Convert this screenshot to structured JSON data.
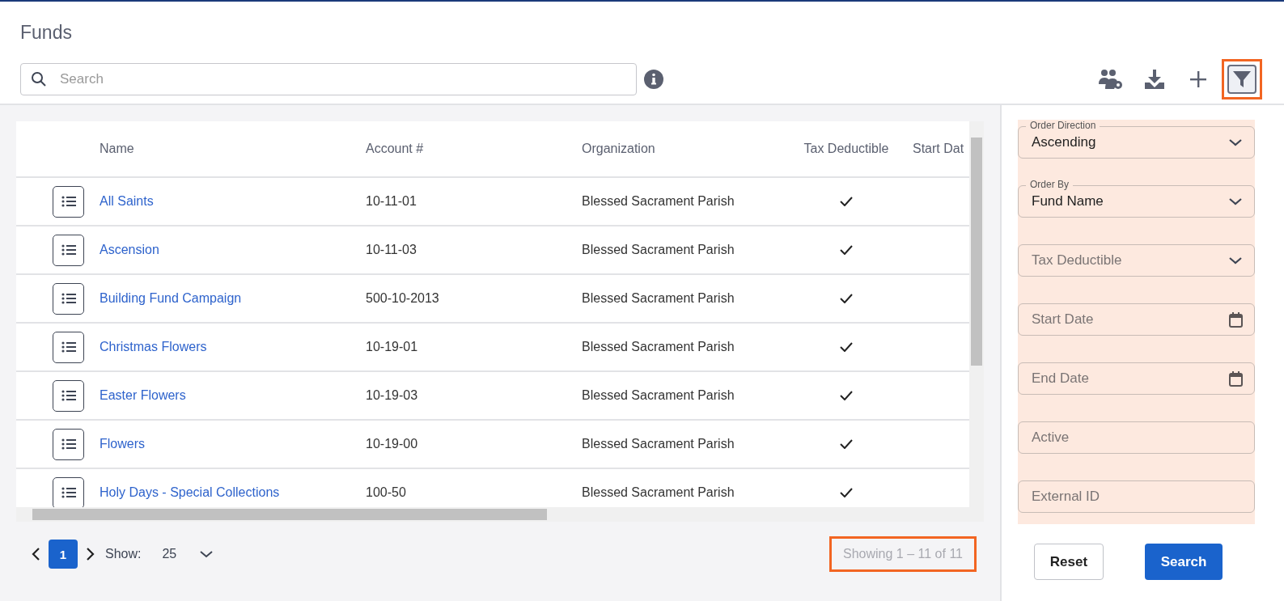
{
  "page": {
    "title": "Funds"
  },
  "search": {
    "placeholder": "Search"
  },
  "toolbar": [
    {
      "kind": "people-settings",
      "highlighted": false,
      "selected": false
    },
    {
      "kind": "download",
      "highlighted": false,
      "selected": false
    },
    {
      "kind": "add",
      "highlighted": false,
      "selected": false
    },
    {
      "kind": "filter",
      "highlighted": true,
      "selected": true
    }
  ],
  "table": {
    "columns": [
      "Name",
      "Account #",
      "Organization",
      "Tax Deductible",
      "Start Dat"
    ],
    "rows": [
      {
        "name": "All Saints",
        "account": "10-11-01",
        "organization": "Blessed Sacrament Parish",
        "tax_deductible": true
      },
      {
        "name": "Ascension",
        "account": "10-11-03",
        "organization": "Blessed Sacrament Parish",
        "tax_deductible": true
      },
      {
        "name": "Building Fund Campaign",
        "account": "500-10-2013",
        "organization": "Blessed Sacrament Parish",
        "tax_deductible": true
      },
      {
        "name": "Christmas Flowers",
        "account": "10-19-01",
        "organization": "Blessed Sacrament Parish",
        "tax_deductible": true
      },
      {
        "name": "Easter Flowers",
        "account": "10-19-03",
        "organization": "Blessed Sacrament Parish",
        "tax_deductible": true
      },
      {
        "name": "Flowers",
        "account": "10-19-00",
        "organization": "Blessed Sacrament Parish",
        "tax_deductible": true
      },
      {
        "name": "Holy Days - Special Collections",
        "account": "100-50",
        "organization": "Blessed Sacrament Parish",
        "tax_deductible": true
      }
    ]
  },
  "pagination": {
    "pages": [
      {
        "label": "1",
        "selected": true
      }
    ],
    "show_label": "Show:",
    "page_size": "25",
    "summary": "Showing 1 – 11 of 11",
    "summary_highlighted": true
  },
  "filter_panel": {
    "highlighted": true,
    "fields": [
      {
        "kind": "select",
        "label": "Order Direction",
        "value": "Ascending"
      },
      {
        "kind": "select",
        "label": "Order By",
        "value": "Fund Name"
      },
      {
        "kind": "select",
        "placeholder": "Tax Deductible"
      },
      {
        "kind": "date",
        "placeholder": "Start Date"
      },
      {
        "kind": "date",
        "placeholder": "End Date"
      },
      {
        "kind": "text",
        "placeholder": "Active"
      },
      {
        "kind": "text",
        "placeholder": "External ID"
      }
    ],
    "buttons": [
      {
        "label": "Reset",
        "kind": "secondary"
      },
      {
        "label": "Search",
        "kind": "primary"
      }
    ]
  }
}
